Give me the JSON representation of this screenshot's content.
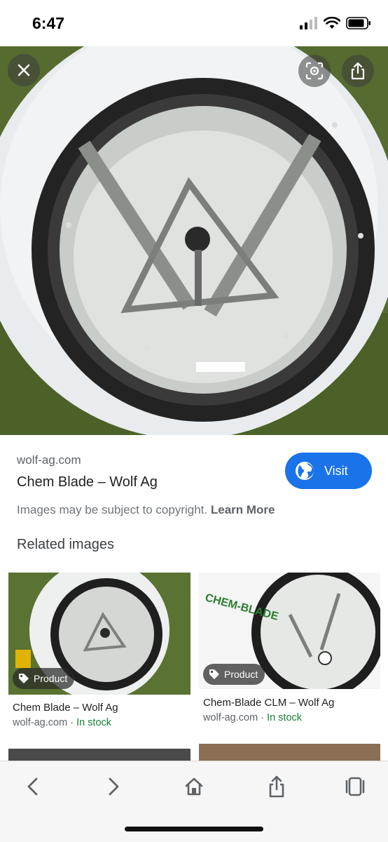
{
  "status_bar": {
    "time": "6:47"
  },
  "result": {
    "source": "wolf-ag.com",
    "title": "Chem Blade – Wolf Ag",
    "visit_label": "Visit",
    "copyright_text": "Images may be subject to copyright.",
    "learn_more": "Learn More"
  },
  "related": {
    "heading": "Related images",
    "items": [
      {
        "badge": "Product",
        "title": "Chem Blade – Wolf Ag",
        "source": "wolf-ag.com",
        "separator": " · ",
        "stock": "In stock"
      },
      {
        "badge": "Product",
        "title": "Chem-Blade CLM – Wolf Ag",
        "source": "wolf-ag.com",
        "separator": " · ",
        "stock": "In stock",
        "image_text": "CHEM-BLADE"
      }
    ]
  },
  "colors": {
    "accent": "#1a73e8",
    "in_stock": "#188038",
    "grass": "#4a6a2a"
  },
  "icons": [
    "close-icon",
    "lens-icon",
    "share-icon",
    "globe-icon",
    "tag-icon",
    "back-icon",
    "forward-icon",
    "home-icon",
    "share-icon",
    "tabs-icon"
  ]
}
